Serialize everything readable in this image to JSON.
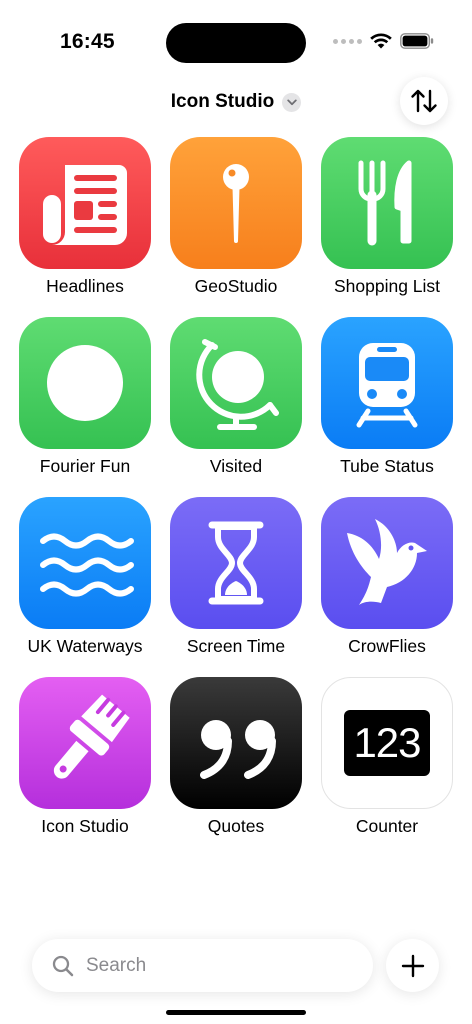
{
  "status_bar": {
    "time": "16:45"
  },
  "header": {
    "title": "Icon Studio"
  },
  "apps": [
    {
      "label": "Headlines",
      "icon": "newspaper-icon",
      "gradient": [
        "#ff5b5b",
        "#e8303a"
      ]
    },
    {
      "label": "GeoStudio",
      "icon": "map-pin-icon",
      "gradient": [
        "#ffa23a",
        "#f77f1c"
      ]
    },
    {
      "label": "Shopping List",
      "icon": "fork-knife-icon",
      "gradient": [
        "#5fdc72",
        "#35c152"
      ]
    },
    {
      "label": "Fourier Fun",
      "icon": "circle-icon",
      "gradient": [
        "#5fdc72",
        "#35c152"
      ]
    },
    {
      "label": "Visited",
      "icon": "globe-icon",
      "gradient": [
        "#5fdc72",
        "#35c152"
      ]
    },
    {
      "label": "Tube Status",
      "icon": "train-icon",
      "gradient": [
        "#2aa3ff",
        "#0a7cf5"
      ]
    },
    {
      "label": "UK Waterways",
      "icon": "water-waves-icon",
      "gradient": [
        "#2aa3ff",
        "#0a7cf5"
      ]
    },
    {
      "label": "Screen Time",
      "icon": "hourglass-icon",
      "gradient": [
        "#7b6cf6",
        "#5a4ef0"
      ]
    },
    {
      "label": "CrowFlies",
      "icon": "bird-icon",
      "gradient": [
        "#7b6cf6",
        "#5a4ef0"
      ]
    },
    {
      "label": "Icon Studio",
      "icon": "paintbrush-icon",
      "gradient": [
        "#e45ff2",
        "#b52fdc"
      ]
    },
    {
      "label": "Quotes",
      "icon": "quote-icon",
      "gradient": [
        "#3a3a3a",
        "#000000"
      ]
    },
    {
      "label": "Counter",
      "icon": "counter-123-icon",
      "gradient": [
        "#ffffff",
        "#ffffff"
      ],
      "counter_text": "123"
    }
  ],
  "search": {
    "placeholder": "Search",
    "value": ""
  }
}
